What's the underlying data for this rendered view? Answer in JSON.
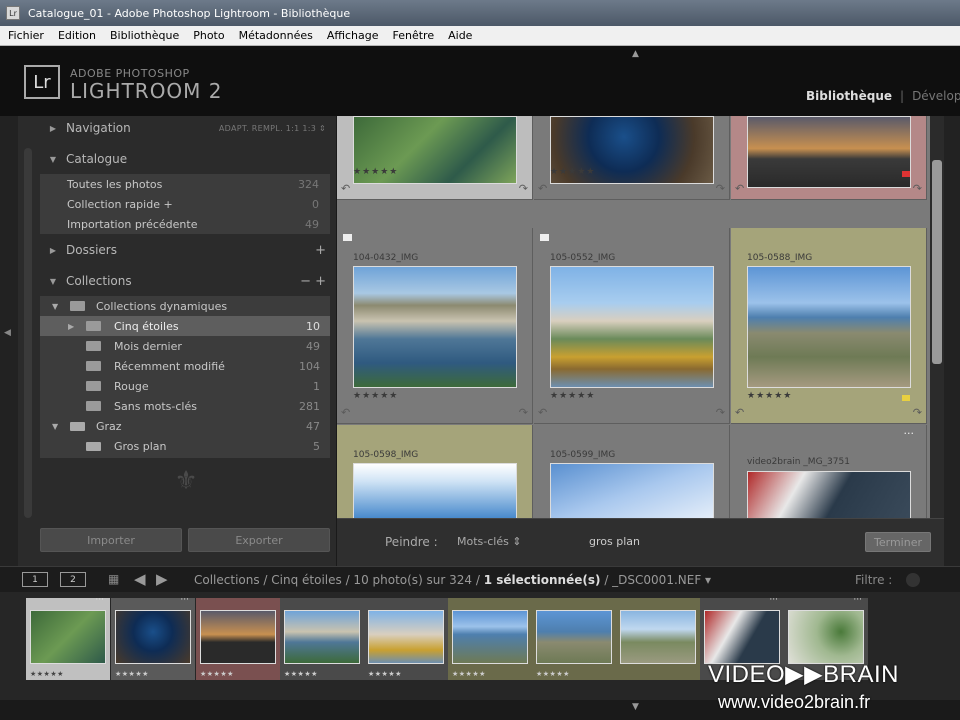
{
  "window": {
    "title": "Catalogue_01 - Adobe Photoshop Lightroom - Bibliothèque",
    "icon_label": "Lr"
  },
  "menu": [
    "Fichier",
    "Edition",
    "Bibliothèque",
    "Photo",
    "Métadonnées",
    "Affichage",
    "Fenêtre",
    "Aide"
  ],
  "identity": {
    "logo": "Lr",
    "line1": "ADOBE PHOTOSHOP",
    "line2": "LIGHTROOM 2"
  },
  "modules": {
    "active": "Bibliothèque",
    "next": "Dévelop"
  },
  "left_panel": {
    "navigation": {
      "title": "Navigation",
      "options": "ADAPT.   REMPL.   1:1   1:3 ⇕"
    },
    "catalogue": {
      "title": "Catalogue",
      "items": [
        {
          "label": "Toutes les photos",
          "count": "324"
        },
        {
          "label": "Collection rapide +",
          "count": "0"
        },
        {
          "label": "Importation précédente",
          "count": "49"
        }
      ]
    },
    "dossiers": {
      "title": "Dossiers",
      "action": "+"
    },
    "collections": {
      "title": "Collections",
      "actions": "− +",
      "items": [
        {
          "label": "Collections dynamiques",
          "count": ""
        },
        {
          "label": "Cinq étoiles",
          "count": "10"
        },
        {
          "label": "Mois dernier",
          "count": "49"
        },
        {
          "label": "Récemment modifié",
          "count": "104"
        },
        {
          "label": "Rouge",
          "count": "1"
        },
        {
          "label": "Sans mots-clés",
          "count": "281"
        },
        {
          "label": "Graz",
          "count": "47"
        },
        {
          "label": "Gros plan",
          "count": "5"
        }
      ]
    },
    "import_button": "Importer",
    "export_button": "Exporter"
  },
  "grid": {
    "cells": [
      {
        "name": "",
        "stars": "★★★★★"
      },
      {
        "name": "",
        "stars": "★★★★★"
      },
      {
        "name": "",
        "stars": ""
      },
      {
        "name": "104-0432_IMG",
        "stars": "★★★★★"
      },
      {
        "name": "105-0552_IMG",
        "stars": "★★★★★"
      },
      {
        "name": "105-0588_IMG",
        "stars": "★★★★★"
      },
      {
        "name": "105-0598_IMG",
        "stars": ""
      },
      {
        "name": "105-0599_IMG",
        "stars": ""
      },
      {
        "name": "video2brain _MG_3751",
        "stars": ""
      }
    ]
  },
  "toolbar": {
    "paint_label": "Peindre :",
    "mode": "Mots-clés ⇕",
    "keyword": "gros plan",
    "finish": "Terminer"
  },
  "filmbar": {
    "monitor1": "1",
    "monitor2": "2",
    "path_prefix": "Collections / Cinq étoiles / 10 photo(s) sur 324 / ",
    "selected": "1 sélectionnée(s)",
    "file": " / _DSC0001.NEF ▾",
    "filter_label": "Filtre :"
  },
  "filmstrip": {
    "stars": "★★★★★",
    "count": 10
  },
  "watermark": {
    "brand": "VIDEO▶▶BRAIN",
    "url": "www.video2brain.fr"
  },
  "colors": {
    "panel": "#2b2b2b",
    "grid": "#7a7a7a",
    "red_label": "#b48888",
    "yellow_label": "#a5a47a"
  }
}
